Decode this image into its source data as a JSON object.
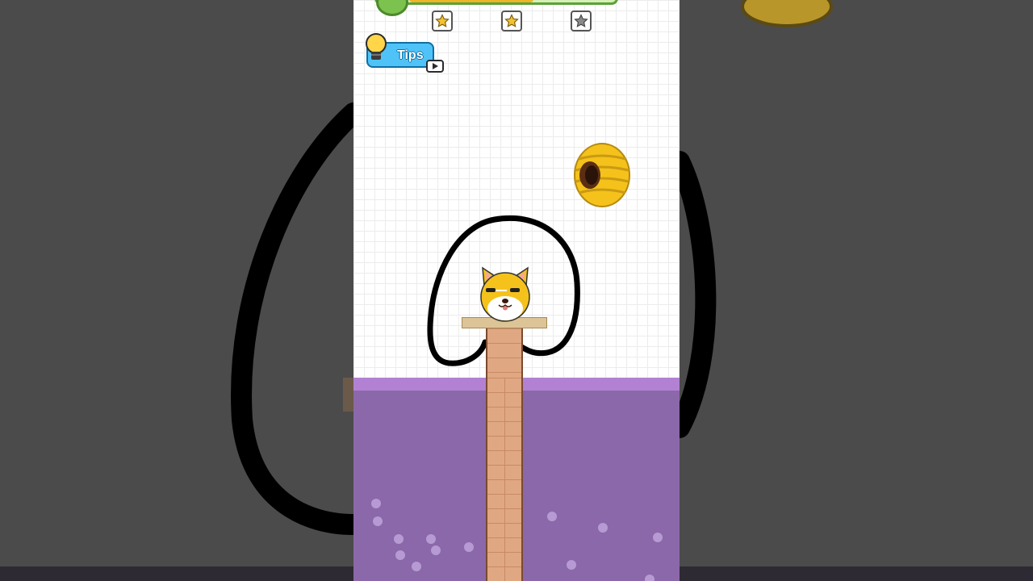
{
  "level": {
    "stars": [
      {
        "id": "star-1",
        "filled": true
      },
      {
        "id": "star-2",
        "filled": true
      },
      {
        "id": "star-3",
        "filled": false
      }
    ],
    "progress_fraction": 0.6
  },
  "tips_button": {
    "label": "Tips",
    "icon": "lightbulb-icon",
    "badge_icon": "video-ad-icon"
  },
  "scene": {
    "hazard": "beehive-icon",
    "character": "dog-icon",
    "platform": "wooden-plank",
    "pillar": "brick-pillar",
    "liquid": "purple-water"
  },
  "colors": {
    "water": "#8b68a9",
    "water_surface": "#b381d4",
    "progress_border": "#5aa23a",
    "tips_button": "#4fc3f7",
    "drawn_line": "#000000",
    "star": "#f2c230"
  }
}
